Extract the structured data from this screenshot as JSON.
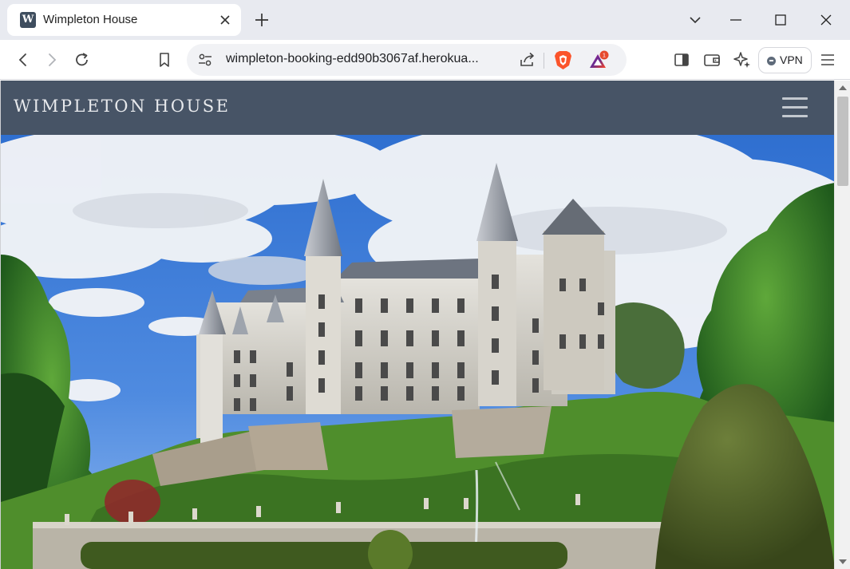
{
  "browser": {
    "tab": {
      "favicon_letter": "W",
      "title": "Wimpleton House"
    },
    "url": "wimpleton-booking-edd90b3067af.herokua...",
    "notification_count": "1",
    "vpn_label": "VPN",
    "icons": {
      "back": "back-arrow-icon",
      "forward": "forward-arrow-icon",
      "reload": "reload-icon",
      "bookmark": "bookmark-icon",
      "site_info": "site-settings-icon",
      "share": "share-icon",
      "shields": "brave-shields-icon",
      "rewards": "brave-rewards-icon",
      "sidebar": "sidebar-icon",
      "wallet": "wallet-icon",
      "leo": "leo-ai-icon",
      "menu": "menu-icon"
    }
  },
  "site": {
    "brand": "WIMPLETON HOUSE",
    "nav_bg": "#475466",
    "hero_alt": "Castle with spired towers on a green hillside garden"
  }
}
